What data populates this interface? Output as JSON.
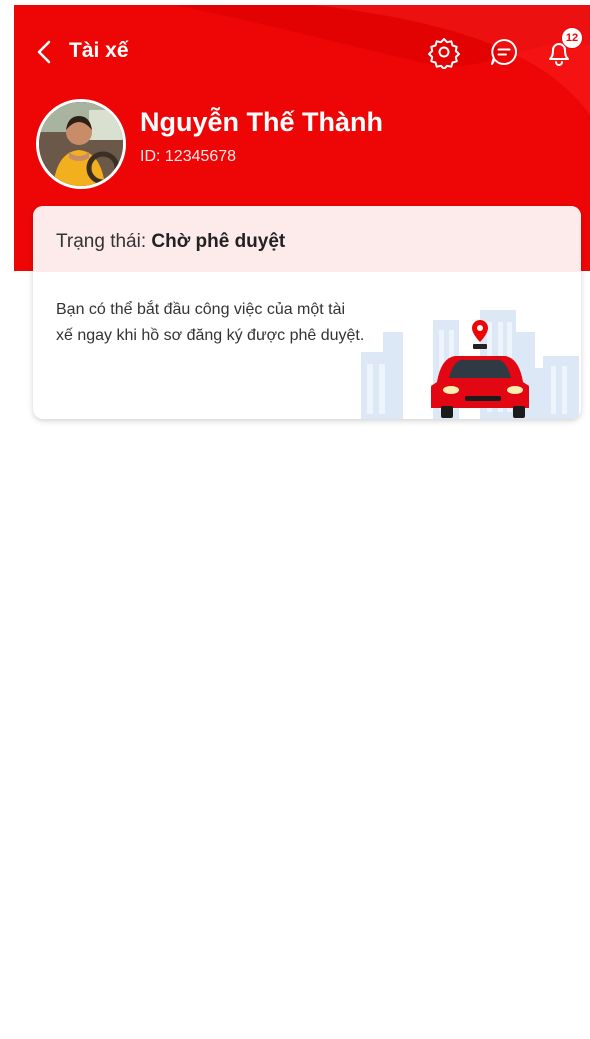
{
  "header": {
    "back_icon": "chevron-left-icon",
    "title": "Tài xế",
    "settings_icon": "gear-icon",
    "chat_icon": "chat-icon",
    "notification_icon": "bell-icon",
    "notification_count": "12"
  },
  "profile": {
    "name": "Nguyễn Thế Thành",
    "id_text": "ID: 12345678"
  },
  "status_card": {
    "status_label": "Trạng thái: ",
    "status_value": "Chờ phê duyệt",
    "description": "Bạn có thể bắt đầu công việc của một tài xế ngay khi hồ sơ đăng ký được phê duyệt.",
    "illustration": "red-taxi-city-illustration"
  },
  "colors": {
    "primary_red": "#ee0606",
    "card_header_bg": "#fdeaea"
  }
}
